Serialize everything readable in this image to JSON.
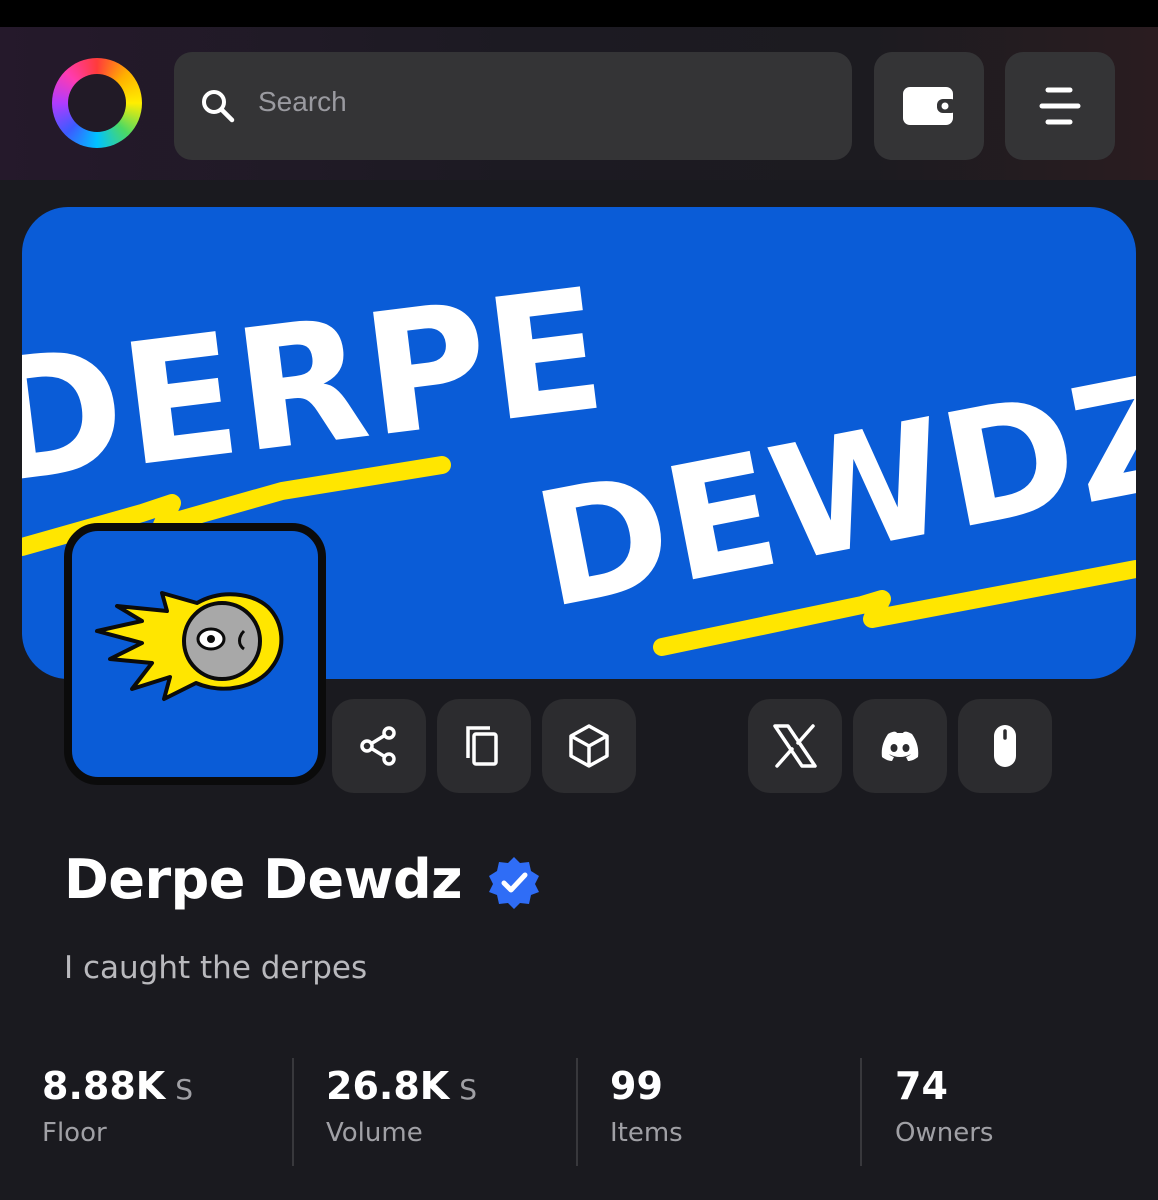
{
  "search": {
    "placeholder": "Search"
  },
  "header": {
    "wallet_icon": "wallet-icon",
    "menu_icon": "menu-icon"
  },
  "banner": {
    "text": [
      "DERPE",
      "DEWDZ"
    ]
  },
  "actions": [
    {
      "icon": "share-icon"
    },
    {
      "icon": "copy-icon"
    },
    {
      "icon": "cube-icon"
    }
  ],
  "socials": [
    {
      "icon": "x-icon"
    },
    {
      "icon": "discord-icon"
    },
    {
      "icon": "mouse-icon"
    }
  ],
  "collection": {
    "name": "Derpe Dewdz",
    "verified": true,
    "description": "I caught the derpes"
  },
  "stats": [
    {
      "value": "8.88K",
      "unit": "S",
      "label": "Floor"
    },
    {
      "value": "26.8K",
      "unit": "S",
      "label": "Volume"
    },
    {
      "value": "99",
      "unit": "",
      "label": "Items"
    },
    {
      "value": "74",
      "unit": "",
      "label": "Owners"
    }
  ],
  "colors": {
    "background": "#1a1a1f",
    "banner_blue": "#0a5cd7",
    "accent_yellow": "#ffe600",
    "verified_blue": "#2f6df6"
  }
}
